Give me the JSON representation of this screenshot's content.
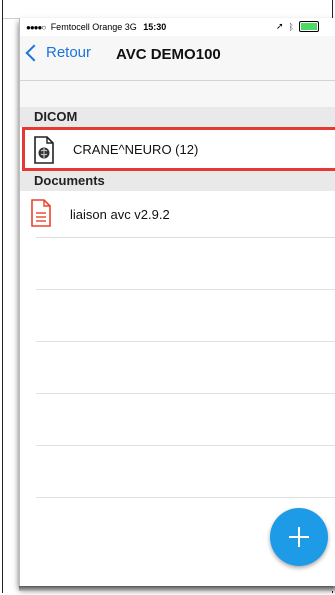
{
  "status_bar": {
    "signal_dots": "●●●●○",
    "carrier": "Femtocell Orange",
    "network": "3G",
    "time": "15:30"
  },
  "nav": {
    "back_label": "Retour",
    "title": "AVC DEMO100"
  },
  "sections": [
    {
      "header": "DICOM",
      "items": [
        {
          "label": "CRANE^NEURO (12)",
          "icon": "dicom-brain-file-icon",
          "highlighted": true
        }
      ]
    },
    {
      "header": "Documents",
      "items": [
        {
          "label": "liaison avc v2.9.2",
          "icon": "document-file-icon"
        }
      ]
    }
  ],
  "colors": {
    "accent": "#1a73d9",
    "fab": "#1e9be6",
    "highlight": "#e53935",
    "document_icon": "#e8452c"
  },
  "fab": {
    "icon": "plus-icon"
  }
}
